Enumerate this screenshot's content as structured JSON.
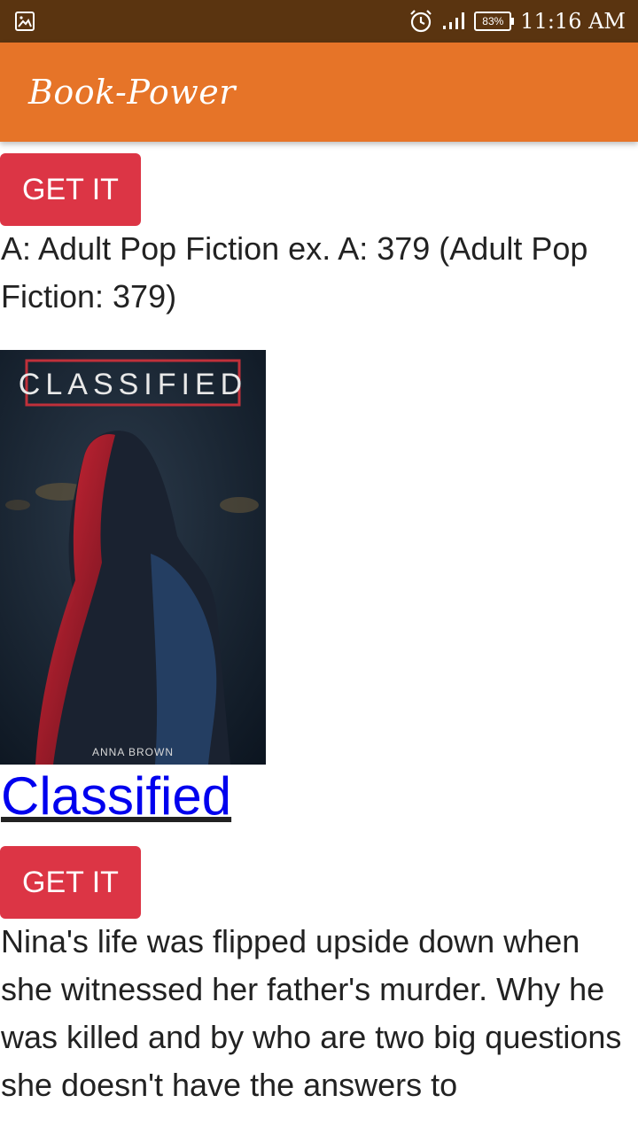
{
  "status_bar": {
    "battery": "83%",
    "time": "11:16 AM",
    "left_icon": "image-icon",
    "icons": [
      "alarm-icon",
      "signal-icon",
      "battery-icon"
    ]
  },
  "app_bar": {
    "title": "Book-Power",
    "color": "#e67428"
  },
  "items": [
    {
      "button_label": "GET IT",
      "text": "A: Adult Pop Fiction ex. A: 379 (Adult Pop Fiction: 379)"
    },
    {
      "cover_title": "CLASSIFIED",
      "cover_author": "ANNA BROWN",
      "link_title": "Classified",
      "button_label": "GET IT",
      "text": "Nina's life was flipped upside down when she witnessed her father's murder. Why he was killed and by who are two big questions she doesn't have the answers to"
    }
  ],
  "colors": {
    "status_bar": "#5a3410",
    "button": "#dc3545",
    "link": "#0000ee"
  }
}
